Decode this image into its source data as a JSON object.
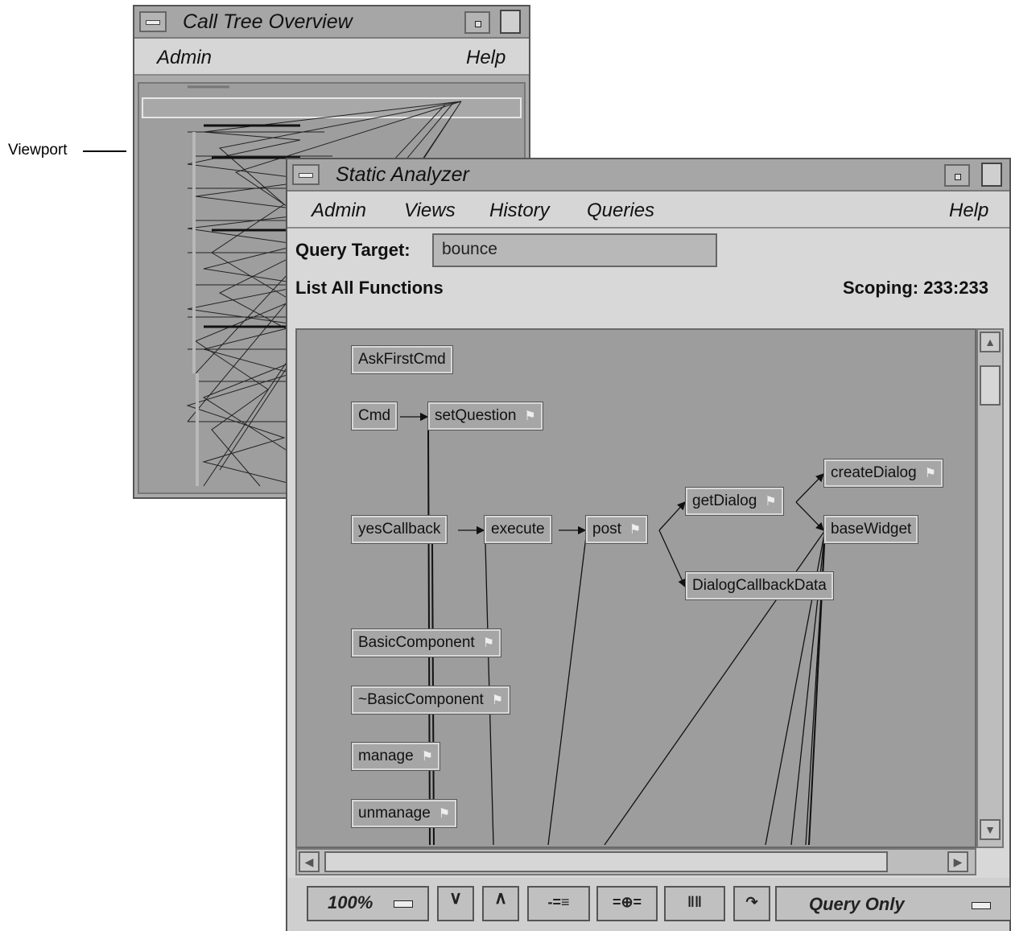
{
  "annotation": {
    "viewport_label": "Viewport"
  },
  "call_tree_overview": {
    "title": "Call Tree Overview",
    "menu": {
      "admin": "Admin",
      "help": "Help"
    }
  },
  "static_analyzer": {
    "title": "Static Analyzer",
    "menu": {
      "admin": "Admin",
      "views": "Views",
      "history": "History",
      "queries": "Queries",
      "help": "Help"
    },
    "query_target_label": "Query Target:",
    "query_target_value": "bounce",
    "query_description": "List All Functions",
    "scoping": "Scoping: 233:233",
    "nodes": {
      "askfirstcmd": "AskFirstCmd",
      "cmd": "Cmd",
      "setquestion": "setQuestion",
      "yescallback": "yesCallback",
      "execute": "execute",
      "post": "post",
      "getdialog": "getDialog",
      "createdialog": "createDialog",
      "basewidget": "baseWidget",
      "dialogcallbackdata": "DialogCallbackData",
      "basiccomponent": "BasicComponent",
      "destructor": "~BasicComponent",
      "manage": "manage",
      "unmanage": "unmanage"
    },
    "toolbar": {
      "zoom": "100%",
      "mode": "Query Only"
    }
  }
}
